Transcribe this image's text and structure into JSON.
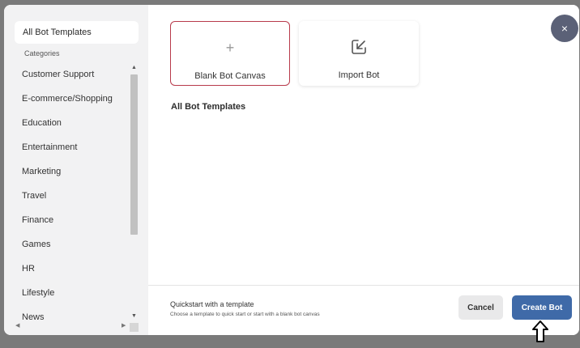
{
  "sidebar": {
    "active_item": "All Bot Templates",
    "categories_heading": "Categories",
    "items": [
      {
        "label": "Customer Support"
      },
      {
        "label": "E-commerce/Shopping"
      },
      {
        "label": "Education"
      },
      {
        "label": "Entertainment"
      },
      {
        "label": "Marketing"
      },
      {
        "label": "Travel"
      },
      {
        "label": "Finance"
      },
      {
        "label": "Games"
      },
      {
        "label": "HR"
      },
      {
        "label": "Lifestyle"
      },
      {
        "label": "News"
      }
    ]
  },
  "main": {
    "cards": [
      {
        "label": "Blank Bot Canvas",
        "icon": "plus-icon"
      },
      {
        "label": "Import Bot",
        "icon": "import-icon"
      }
    ],
    "section_title": "All Bot Templates",
    "close_label": "×"
  },
  "footer": {
    "title": "Quickstart with a template",
    "subtitle": "Choose a template to quick start or start with a blank bot canvas",
    "cancel_label": "Cancel",
    "create_label": "Create Bot"
  },
  "colors": {
    "accent": "#3f6aa8",
    "selected_border": "#b83a4b",
    "close_bg": "#5b6177"
  }
}
